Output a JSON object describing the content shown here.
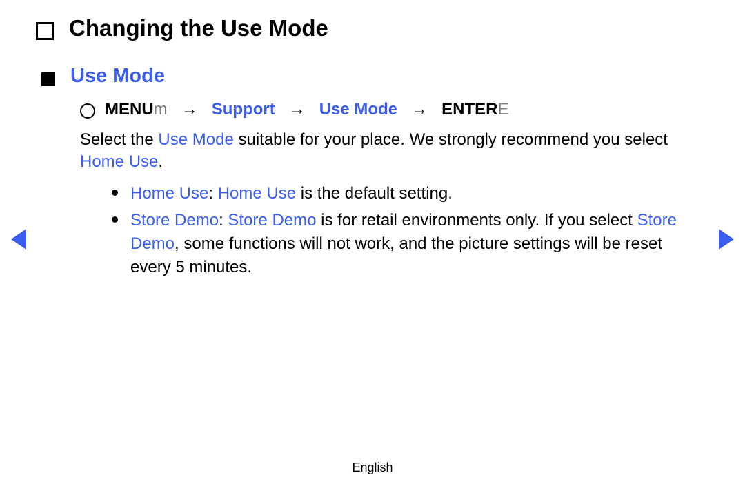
{
  "title": "Changing the Use Mode",
  "section": "Use Mode",
  "nav": {
    "menu_bold": "MENU",
    "menu_thin": "m",
    "arrow": "→",
    "support": "Support",
    "use_mode": "Use Mode",
    "enter_bold": "ENTER",
    "enter_thin": "E"
  },
  "body": {
    "p1a": "Select the ",
    "p1_blue": "Use Mode",
    "p1b": " suitable for your place. We strongly recommend you select ",
    "p1_blue2": "Home Use",
    "p1c": "."
  },
  "bullets": [
    {
      "blue1": "Home Use",
      "sep": ": ",
      "blue2": "Home Use",
      "rest": " is the default setting."
    },
    {
      "blue1": "Store Demo",
      "sep": ": ",
      "blue2": "Store Demo",
      "rest1": " is for retail environments only. If you select ",
      "blue3": "Store Demo",
      "rest2": ", some functions will not work, and the picture settings will be reset every 5 minutes."
    }
  ],
  "footer": "English"
}
